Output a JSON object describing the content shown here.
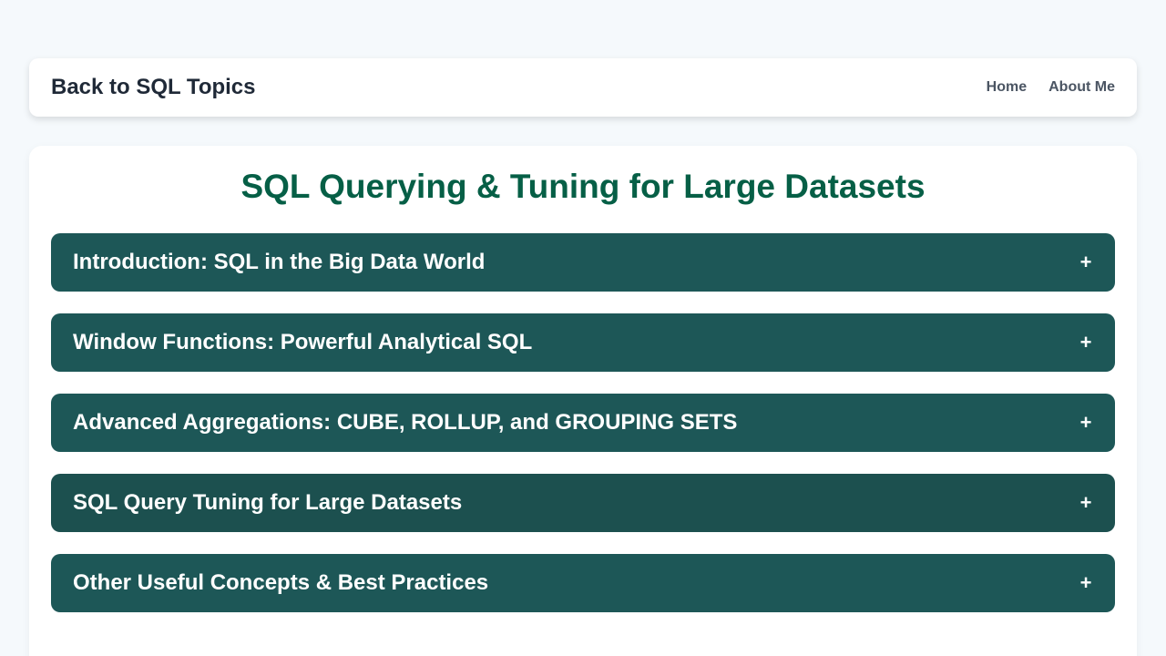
{
  "nav": {
    "brand": "Back to SQL Topics",
    "links": [
      {
        "label": "Home"
      },
      {
        "label": "About Me"
      }
    ]
  },
  "main": {
    "title": "SQL Querying & Tuning for Large Datasets",
    "sections": [
      {
        "title": "Introduction: SQL in the Big Data World",
        "icon": "+",
        "icon_name": "plus-icon"
      },
      {
        "title": "Window Functions: Powerful Analytical SQL",
        "icon": "+",
        "icon_name": "plus-icon"
      },
      {
        "title": "Advanced Aggregations: CUBE, ROLLUP, and GROUPING SETS",
        "icon": "+",
        "icon_name": "plus-icon"
      },
      {
        "title": "SQL Query Tuning for Large Datasets",
        "icon": "+",
        "icon_name": "plus-icon"
      },
      {
        "title": "Other Useful Concepts & Best Practices",
        "icon": "+",
        "icon_name": "plus-icon"
      }
    ]
  },
  "colors": {
    "page_background": "#f5f9fc",
    "title": "#065f46",
    "accordion_header": "#1d5757",
    "accordion_header_hover": "#1c504f"
  }
}
